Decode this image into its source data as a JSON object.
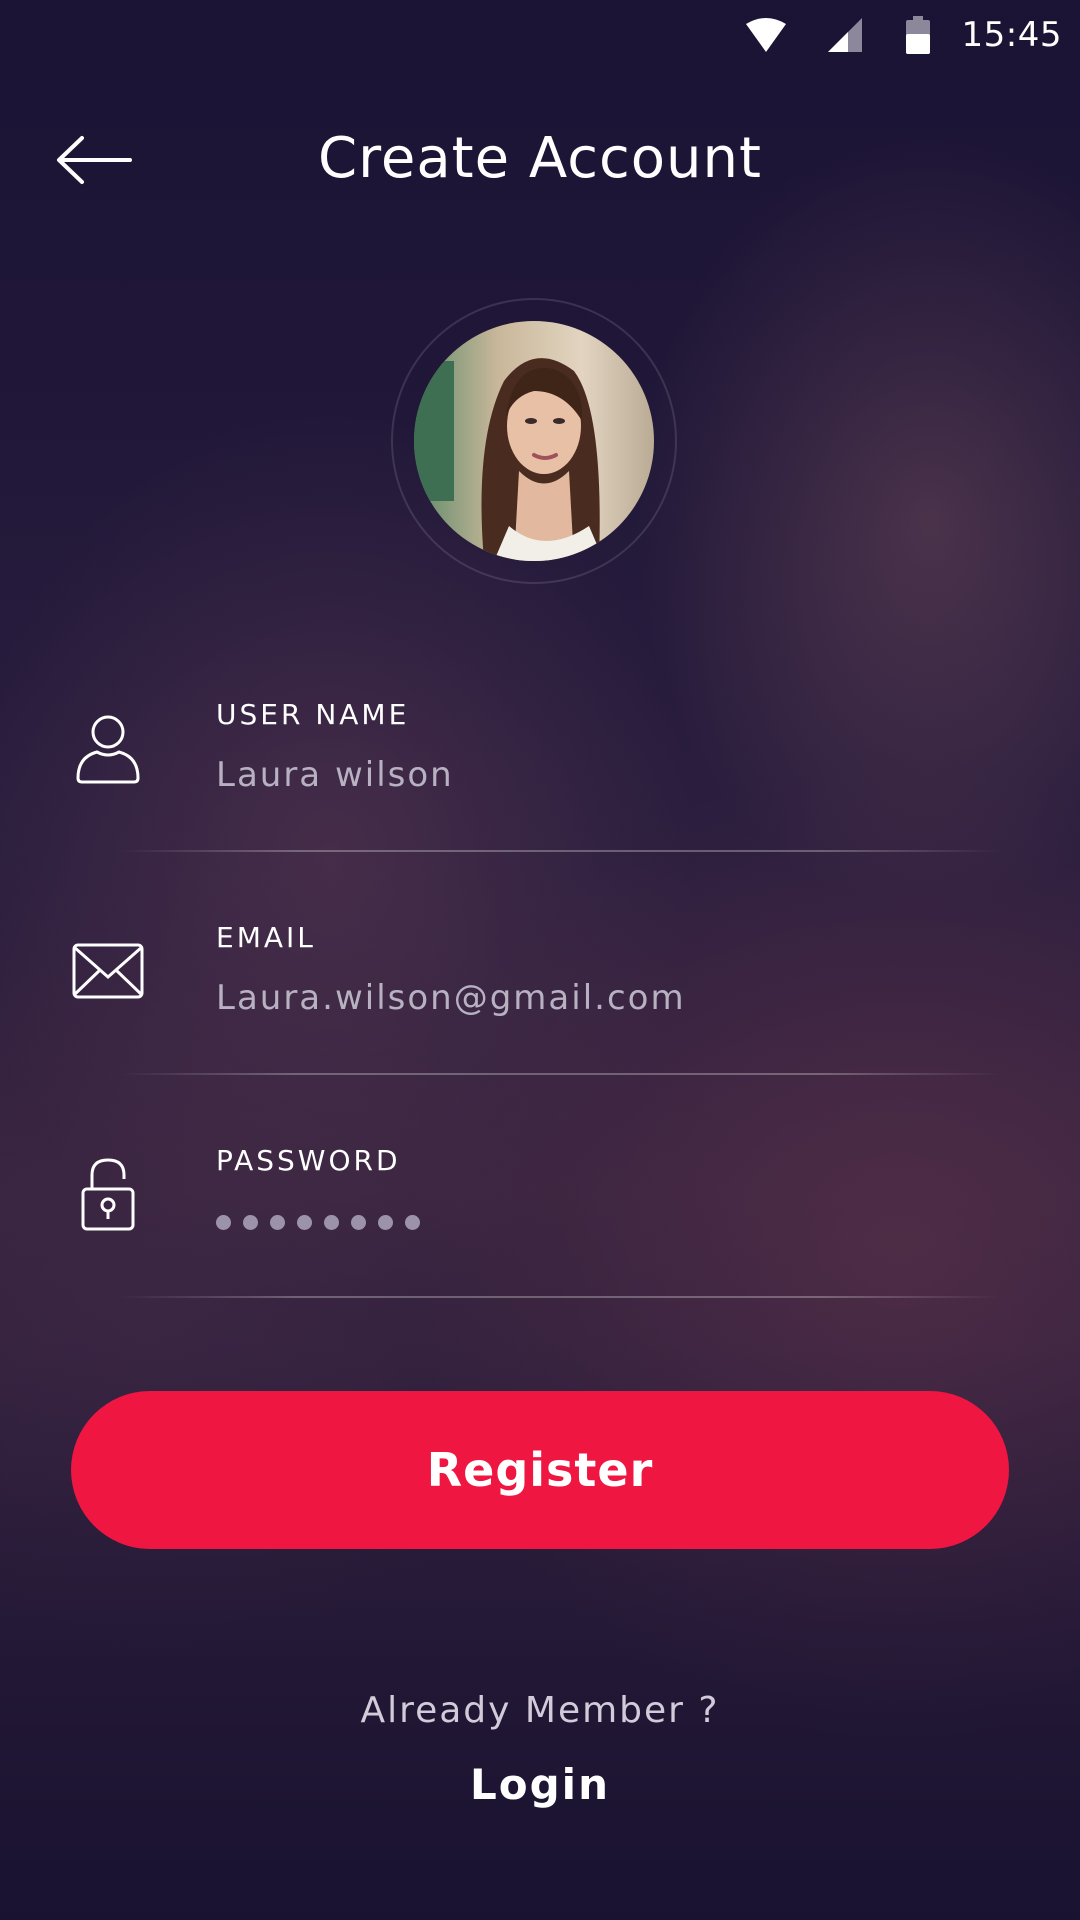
{
  "status_bar": {
    "time": "15:45",
    "icons": [
      "wifi-icon",
      "cell-signal-icon",
      "battery-icon"
    ]
  },
  "header": {
    "back_icon": "arrow-left-icon",
    "title": "Create Account"
  },
  "avatar": {
    "description_icon": "user-photo"
  },
  "form": {
    "username": {
      "icon": "user-icon",
      "label": "USER NAME",
      "value": "Laura wilson"
    },
    "email": {
      "icon": "envelope-icon",
      "label": "EMAIL",
      "value": "Laura.wilson@gmail.com"
    },
    "password": {
      "icon": "unlocked-padlock-icon",
      "label": "PASSWORD",
      "masked_length": 8
    }
  },
  "actions": {
    "register_label": "Register",
    "already_member_text": "Already Member ?",
    "login_label": "Login"
  },
  "colors": {
    "accent": "#ef1642",
    "background": "#1e1535",
    "muted_text": "#b7b1c2"
  }
}
